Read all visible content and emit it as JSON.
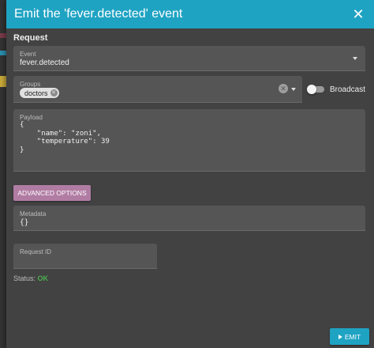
{
  "dialog": {
    "title": "Emit the 'fever.detected' event",
    "close_glyph": "✕"
  },
  "request": {
    "section_label": "Request",
    "event": {
      "label": "Event",
      "value": "fever.detected"
    },
    "groups": {
      "label": "Groups",
      "chips": [
        "doctors"
      ]
    },
    "broadcast": {
      "label": "Broadcast",
      "enabled": false
    },
    "payload": {
      "label": "Payload",
      "value": "{\n    \"name\": \"zoni\",\n    \"temperature\": 39\n}"
    },
    "advanced_options_label": "ADVANCED OPTIONS",
    "metadata": {
      "label": "Metadata",
      "value": "{}"
    },
    "request_id": {
      "label": "Request ID",
      "value": ""
    }
  },
  "status": {
    "label": "Status:",
    "value": "OK"
  },
  "emit_button_label": "EMIT",
  "colors": {
    "accent": "#1fa3c3",
    "advanced_button": "#b17ca4",
    "status_ok": "#4caf50",
    "surface": "#424242",
    "field": "#555555"
  },
  "icons": {
    "close": "close-icon",
    "dropdown": "chevron-down-icon",
    "clear": "clear-icon",
    "chip_remove": "remove-chip-icon",
    "emit": "send-icon"
  }
}
